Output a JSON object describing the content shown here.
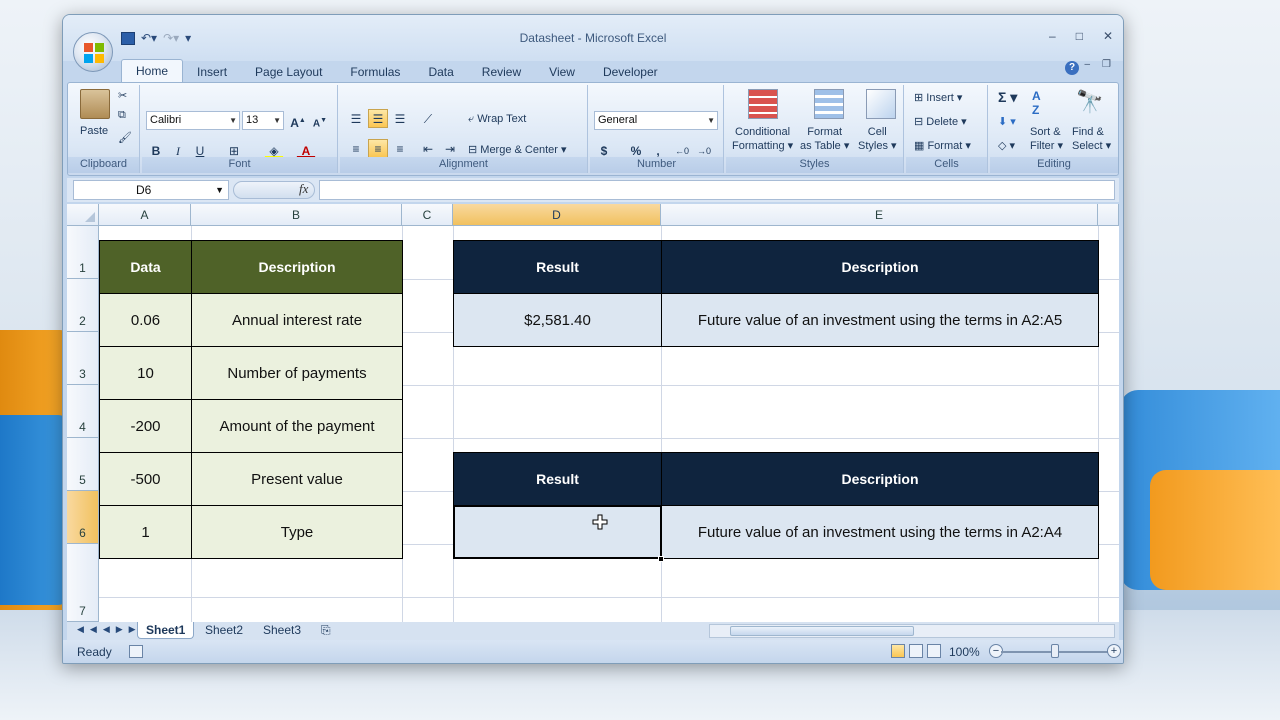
{
  "window": {
    "title": "Datasheet - Microsoft Excel"
  },
  "ribbon_tabs": [
    "Home",
    "Insert",
    "Page Layout",
    "Formulas",
    "Data",
    "Review",
    "View",
    "Developer"
  ],
  "ribbon": {
    "clipboard": {
      "paste": "Paste",
      "label": "Clipboard"
    },
    "font": {
      "name": "Calibri",
      "size": "13",
      "bold": "B",
      "italic": "I",
      "underline": "U",
      "label": "Font"
    },
    "alignment": {
      "wrap_text": "Wrap Text",
      "merge_center": "Merge & Center",
      "label": "Alignment"
    },
    "number": {
      "format": "General",
      "currency": "$",
      "percent": "%",
      "comma": ",",
      "label": "Number"
    },
    "styles": {
      "conditional_1": "Conditional",
      "conditional_2": "Formatting",
      "format_table_1": "Format",
      "format_table_2": "as Table",
      "cell_styles_1": "Cell",
      "cell_styles_2": "Styles",
      "label": "Styles"
    },
    "cells": {
      "insert": "Insert",
      "delete": "Delete",
      "format": "Format",
      "label": "Cells"
    },
    "editing": {
      "sort_1": "Sort &",
      "sort_2": "Filter",
      "find_1": "Find &",
      "find_2": "Select",
      "label": "Editing",
      "sigma": "Σ"
    }
  },
  "formula_bar": {
    "name_box": "D6",
    "fx": "fx",
    "formula": ""
  },
  "columns": [
    "A",
    "B",
    "C",
    "D",
    "E"
  ],
  "rows": [
    "1",
    "2",
    "3",
    "4",
    "5",
    "6",
    "7"
  ],
  "table_left": {
    "headers": [
      "Data",
      "Description"
    ],
    "rows": [
      [
        "0.06",
        "Annual interest rate"
      ],
      [
        "10",
        "Number of payments"
      ],
      [
        "-200",
        "Amount of the payment"
      ],
      [
        "-500",
        "Present value"
      ],
      [
        "1",
        "Type"
      ]
    ]
  },
  "table_right_1": {
    "headers": [
      "Result",
      "Description"
    ],
    "row": [
      "$2,581.40",
      "Future value of an investment using the terms in A2:A5"
    ]
  },
  "table_right_2": {
    "headers": [
      "Result",
      "Description"
    ],
    "row": [
      "",
      "Future value of an investment using the terms in A2:A4"
    ]
  },
  "sheets": [
    "Sheet1",
    "Sheet2",
    "Sheet3"
  ],
  "status": {
    "mode": "Ready",
    "zoom": "100%"
  }
}
